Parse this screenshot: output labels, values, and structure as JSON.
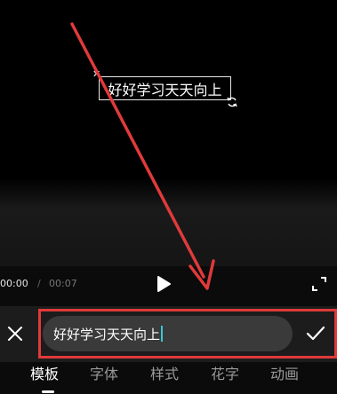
{
  "preview": {
    "overlay_text": "好好学习天天向上"
  },
  "playback": {
    "current_time": "00:00",
    "separator": "/",
    "total_time": "00:07"
  },
  "editor": {
    "input_value": "好好学习天天向上"
  },
  "tabs": [
    {
      "label": "模板",
      "active": true
    },
    {
      "label": "字体",
      "active": false
    },
    {
      "label": "样式",
      "active": false
    },
    {
      "label": "花字",
      "active": false
    },
    {
      "label": "动画",
      "active": false
    }
  ],
  "colors": {
    "annotation_red": "#e03a3a",
    "caret": "#38c7d6",
    "input_bg": "#3a3a3a"
  },
  "icons": [
    "close-handle-icon",
    "rotate-icon",
    "play-icon",
    "fullscreen-icon",
    "close-icon",
    "checkmark-icon"
  ]
}
